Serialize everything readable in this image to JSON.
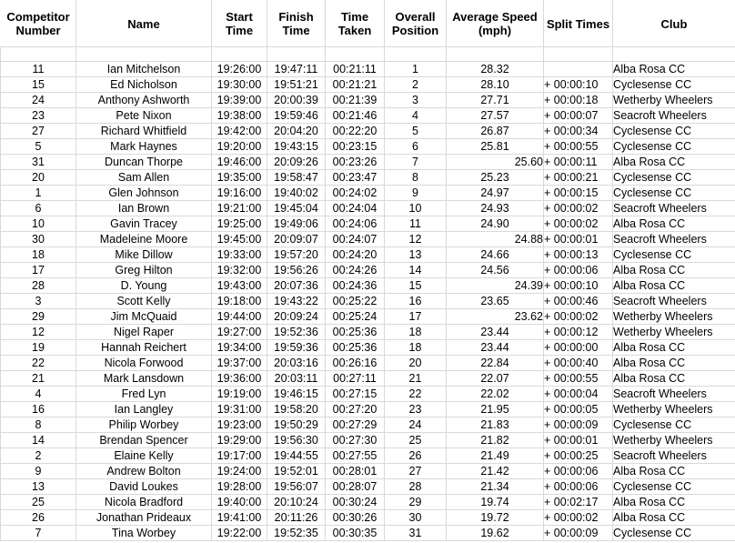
{
  "table": {
    "name": "time-trial-results",
    "columns": [
      {
        "key": "competitor_number",
        "label": "Competitor Number"
      },
      {
        "key": "name",
        "label": "Name"
      },
      {
        "key": "start_time",
        "label": "Start Time"
      },
      {
        "key": "finish_time",
        "label": "Finish Time"
      },
      {
        "key": "time_taken",
        "label": "Time Taken"
      },
      {
        "key": "overall_position",
        "label": "Overall Position"
      },
      {
        "key": "average_speed",
        "label": "Average Speed (mph)"
      },
      {
        "key": "split_times",
        "label": "Split Times"
      },
      {
        "key": "club",
        "label": "Club"
      }
    ],
    "header_labels": {
      "competitor_number_line1": "Competitor",
      "competitor_number_line2": "Number",
      "name": "Name",
      "start_time_line1": "Start",
      "start_time_line2": "Time",
      "finish_time_line1": "Finish",
      "finish_time_line2": "Time",
      "time_taken_line1": "Time",
      "time_taken_line2": "Taken",
      "overall_position_line1": "Overall",
      "overall_position_line2": "Position",
      "average_speed_line1": "Average Speed",
      "average_speed_line2": "(mph)",
      "split_times": "Split Times",
      "club": "Club"
    },
    "rows": [
      {
        "competitor_number": "11",
        "name": "Ian Mitchelson",
        "start_time": "19:26:00",
        "finish_time": "19:47:11",
        "time_taken": "00:21:11",
        "overall_position": "1",
        "average_speed": "28.32",
        "speed_align": "center",
        "split_times": "",
        "club": "Alba Rosa CC"
      },
      {
        "competitor_number": "15",
        "name": "Ed Nicholson",
        "start_time": "19:30:00",
        "finish_time": "19:51:21",
        "time_taken": "00:21:21",
        "overall_position": "2",
        "average_speed": "28.10",
        "speed_align": "center",
        "split_times": "+ 00:00:10",
        "club": "Cyclesense CC"
      },
      {
        "competitor_number": "24",
        "name": "Anthony Ashworth",
        "start_time": "19:39:00",
        "finish_time": "20:00:39",
        "time_taken": "00:21:39",
        "overall_position": "3",
        "average_speed": "27.71",
        "speed_align": "center",
        "split_times": "+ 00:00:18",
        "club": "Wetherby Wheelers"
      },
      {
        "competitor_number": "23",
        "name": "Pete Nixon",
        "start_time": "19:38:00",
        "finish_time": "19:59:46",
        "time_taken": "00:21:46",
        "overall_position": "4",
        "average_speed": "27.57",
        "speed_align": "center",
        "split_times": "+ 00:00:07",
        "club": "Seacroft Wheelers"
      },
      {
        "competitor_number": "27",
        "name": "Richard Whitfield",
        "start_time": "19:42:00",
        "finish_time": "20:04:20",
        "time_taken": "00:22:20",
        "overall_position": "5",
        "average_speed": "26.87",
        "speed_align": "center",
        "split_times": "+ 00:00:34",
        "club": "Cyclesense CC"
      },
      {
        "competitor_number": "5",
        "name": "Mark Haynes",
        "start_time": "19:20:00",
        "finish_time": "19:43:15",
        "time_taken": "00:23:15",
        "overall_position": "6",
        "average_speed": "25.81",
        "speed_align": "center",
        "split_times": "+ 00:00:55",
        "club": "Cyclesense CC"
      },
      {
        "competitor_number": "31",
        "name": "Duncan Thorpe",
        "start_time": "19:46:00",
        "finish_time": "20:09:26",
        "time_taken": "00:23:26",
        "overall_position": "7",
        "average_speed": "25.60",
        "speed_align": "right",
        "split_times": "+ 00:00:11",
        "club": "Alba Rosa CC"
      },
      {
        "competitor_number": "20",
        "name": "Sam Allen",
        "start_time": "19:35:00",
        "finish_time": "19:58:47",
        "time_taken": "00:23:47",
        "overall_position": "8",
        "average_speed": "25.23",
        "speed_align": "center",
        "split_times": "+ 00:00:21",
        "club": "Cyclesense CC"
      },
      {
        "competitor_number": "1",
        "name": "Glen Johnson",
        "start_time": "19:16:00",
        "finish_time": "19:40:02",
        "time_taken": "00:24:02",
        "overall_position": "9",
        "average_speed": "24.97",
        "speed_align": "center",
        "split_times": "+ 00:00:15",
        "club": "Cyclesense CC"
      },
      {
        "competitor_number": "6",
        "name": "Ian Brown",
        "start_time": "19:21:00",
        "finish_time": "19:45:04",
        "time_taken": "00:24:04",
        "overall_position": "10",
        "average_speed": "24.93",
        "speed_align": "center",
        "split_times": "+ 00:00:02",
        "club": "Seacroft Wheelers"
      },
      {
        "competitor_number": "10",
        "name": "Gavin Tracey",
        "start_time": "19:25:00",
        "finish_time": "19:49:06",
        "time_taken": "00:24:06",
        "overall_position": "11",
        "average_speed": "24.90",
        "speed_align": "center",
        "split_times": "+ 00:00:02",
        "club": "Alba Rosa CC"
      },
      {
        "competitor_number": "30",
        "name": "Madeleine Moore",
        "start_time": "19:45:00",
        "finish_time": "20:09:07",
        "time_taken": "00:24:07",
        "overall_position": "12",
        "average_speed": "24.88",
        "speed_align": "right",
        "split_times": "+ 00:00:01",
        "club": "Seacroft Wheelers"
      },
      {
        "competitor_number": "18",
        "name": "Mike Dillow",
        "start_time": "19:33:00",
        "finish_time": "19:57:20",
        "time_taken": "00:24:20",
        "overall_position": "13",
        "average_speed": "24.66",
        "speed_align": "center",
        "split_times": "+ 00:00:13",
        "club": "Cyclesense CC"
      },
      {
        "competitor_number": "17",
        "name": "Greg Hilton",
        "start_time": "19:32:00",
        "finish_time": "19:56:26",
        "time_taken": "00:24:26",
        "overall_position": "14",
        "average_speed": "24.56",
        "speed_align": "center",
        "split_times": "+ 00:00:06",
        "club": "Alba Rosa CC"
      },
      {
        "competitor_number": "28",
        "name": "D. Young",
        "start_time": "19:43:00",
        "finish_time": "20:07:36",
        "time_taken": "00:24:36",
        "overall_position": "15",
        "average_speed": "24.39",
        "speed_align": "right",
        "split_times": "+ 00:00:10",
        "club": "Alba Rosa CC"
      },
      {
        "competitor_number": "3",
        "name": "Scott Kelly",
        "start_time": "19:18:00",
        "finish_time": "19:43:22",
        "time_taken": "00:25:22",
        "overall_position": "16",
        "average_speed": "23.65",
        "speed_align": "center",
        "split_times": "+ 00:00:46",
        "club": "Seacroft Wheelers"
      },
      {
        "competitor_number": "29",
        "name": "Jim McQuaid",
        "start_time": "19:44:00",
        "finish_time": "20:09:24",
        "time_taken": "00:25:24",
        "overall_position": "17",
        "average_speed": "23.62",
        "speed_align": "right",
        "split_times": "+ 00:00:02",
        "club": "Wetherby Wheelers"
      },
      {
        "competitor_number": "12",
        "name": "Nigel Raper",
        "start_time": "19:27:00",
        "finish_time": "19:52:36",
        "time_taken": "00:25:36",
        "overall_position": "18",
        "average_speed": "23.44",
        "speed_align": "center",
        "split_times": "+ 00:00:12",
        "club": "Wetherby Wheelers"
      },
      {
        "competitor_number": "19",
        "name": "Hannah Reichert",
        "start_time": "19:34:00",
        "finish_time": "19:59:36",
        "time_taken": "00:25:36",
        "overall_position": "18",
        "average_speed": "23.44",
        "speed_align": "center",
        "split_times": "+ 00:00:00",
        "club": "Alba Rosa CC"
      },
      {
        "competitor_number": "22",
        "name": "Nicola Forwood",
        "start_time": "19:37:00",
        "finish_time": "20:03:16",
        "time_taken": "00:26:16",
        "overall_position": "20",
        "average_speed": "22.84",
        "speed_align": "center",
        "split_times": "+ 00:00:40",
        "club": "Alba Rosa CC"
      },
      {
        "competitor_number": "21",
        "name": "Mark Lansdown",
        "start_time": "19:36:00",
        "finish_time": "20:03:11",
        "time_taken": "00:27:11",
        "overall_position": "21",
        "average_speed": "22.07",
        "speed_align": "center",
        "split_times": "+ 00:00:55",
        "club": "Alba Rosa CC"
      },
      {
        "competitor_number": "4",
        "name": "Fred Lyn",
        "start_time": "19:19:00",
        "finish_time": "19:46:15",
        "time_taken": "00:27:15",
        "overall_position": "22",
        "average_speed": "22.02",
        "speed_align": "center",
        "split_times": "+ 00:00:04",
        "club": "Seacroft Wheelers"
      },
      {
        "competitor_number": "16",
        "name": "Ian Langley",
        "start_time": "19:31:00",
        "finish_time": "19:58:20",
        "time_taken": "00:27:20",
        "overall_position": "23",
        "average_speed": "21.95",
        "speed_align": "center",
        "split_times": "+ 00:00:05",
        "club": "Wetherby Wheelers"
      },
      {
        "competitor_number": "8",
        "name": "Philip Worbey",
        "start_time": "19:23:00",
        "finish_time": "19:50:29",
        "time_taken": "00:27:29",
        "overall_position": "24",
        "average_speed": "21.83",
        "speed_align": "center",
        "split_times": "+ 00:00:09",
        "club": "Cyclesense CC"
      },
      {
        "competitor_number": "14",
        "name": "Brendan Spencer",
        "start_time": "19:29:00",
        "finish_time": "19:56:30",
        "time_taken": "00:27:30",
        "overall_position": "25",
        "average_speed": "21.82",
        "speed_align": "center",
        "split_times": "+ 00:00:01",
        "club": "Wetherby Wheelers"
      },
      {
        "competitor_number": "2",
        "name": "Elaine Kelly",
        "start_time": "19:17:00",
        "finish_time": "19:44:55",
        "time_taken": "00:27:55",
        "overall_position": "26",
        "average_speed": "21.49",
        "speed_align": "center",
        "split_times": "+ 00:00:25",
        "club": "Seacroft Wheelers"
      },
      {
        "competitor_number": "9",
        "name": "Andrew Bolton",
        "start_time": "19:24:00",
        "finish_time": "19:52:01",
        "time_taken": "00:28:01",
        "overall_position": "27",
        "average_speed": "21.42",
        "speed_align": "center",
        "split_times": "+ 00:00:06",
        "club": "Alba Rosa CC"
      },
      {
        "competitor_number": "13",
        "name": "David Loukes",
        "start_time": "19:28:00",
        "finish_time": "19:56:07",
        "time_taken": "00:28:07",
        "overall_position": "28",
        "average_speed": "21.34",
        "speed_align": "center",
        "split_times": "+ 00:00:06",
        "club": "Cyclesense CC"
      },
      {
        "competitor_number": "25",
        "name": "Nicola Bradford",
        "start_time": "19:40:00",
        "finish_time": "20:10:24",
        "time_taken": "00:30:24",
        "overall_position": "29",
        "average_speed": "19.74",
        "speed_align": "center",
        "split_times": "+ 00:02:17",
        "club": "Alba Rosa CC"
      },
      {
        "competitor_number": "26",
        "name": "Jonathan Prideaux",
        "start_time": "19:41:00",
        "finish_time": "20:11:26",
        "time_taken": "00:30:26",
        "overall_position": "30",
        "average_speed": "19.72",
        "speed_align": "center",
        "split_times": "+ 00:00:02",
        "club": "Alba Rosa CC"
      },
      {
        "competitor_number": "7",
        "name": "Tina Worbey",
        "start_time": "19:22:00",
        "finish_time": "19:52:35",
        "time_taken": "00:30:35",
        "overall_position": "31",
        "average_speed": "19.62",
        "speed_align": "center",
        "split_times": "+ 00:00:09",
        "club": "Cyclesense CC"
      }
    ]
  }
}
